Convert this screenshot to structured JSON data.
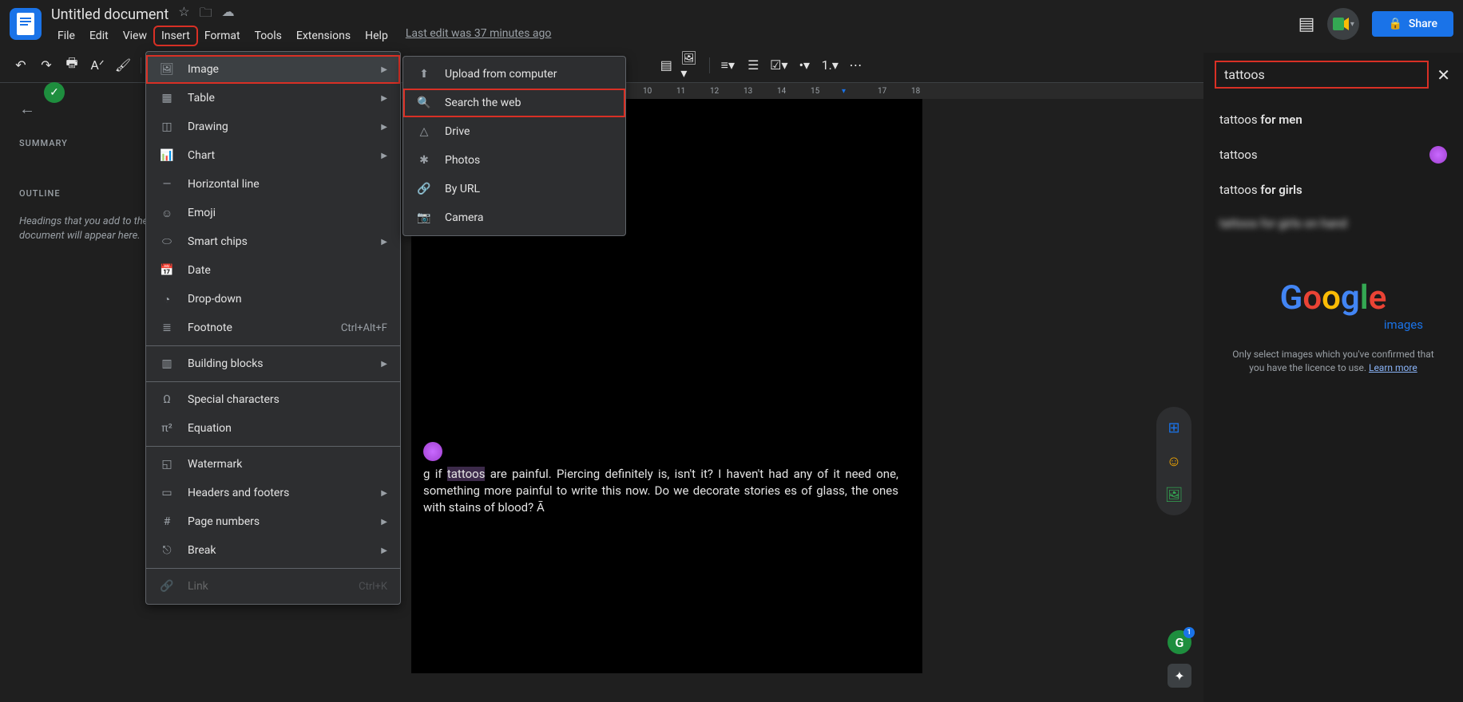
{
  "header": {
    "title": "Untitled document",
    "menus": [
      "File",
      "Edit",
      "View",
      "Insert",
      "Format",
      "Tools",
      "Extensions",
      "Help"
    ],
    "active_menu_index": 3,
    "last_edit": "Last edit was 37 minutes ago",
    "share_label": "Share"
  },
  "left_sidebar": {
    "summary": "SUMMARY",
    "outline": "OUTLINE",
    "hint": "Headings that you add to the document will appear here."
  },
  "ruler_marks": [
    10,
    11,
    12,
    13,
    14,
    15,
    17,
    18
  ],
  "insert_menu": {
    "items": [
      {
        "icon": "image-icon",
        "label": "Image",
        "arrow": true,
        "highlighted": true,
        "red": true
      },
      {
        "icon": "table-icon",
        "label": "Table",
        "arrow": true
      },
      {
        "icon": "drawing-icon",
        "label": "Drawing",
        "arrow": true
      },
      {
        "icon": "chart-icon",
        "label": "Chart",
        "arrow": true
      },
      {
        "icon": "hr-icon",
        "label": "Horizontal line"
      },
      {
        "icon": "emoji-icon",
        "label": "Emoji"
      },
      {
        "icon": "chips-icon",
        "label": "Smart chips",
        "arrow": true
      },
      {
        "icon": "date-icon",
        "label": "Date"
      },
      {
        "icon": "dropdown-icon",
        "label": "Drop-down"
      },
      {
        "icon": "footnote-icon",
        "label": "Footnote",
        "shortcut": "Ctrl+Alt+F"
      },
      {
        "divider": true
      },
      {
        "icon": "blocks-icon",
        "label": "Building blocks",
        "arrow": true
      },
      {
        "divider": true
      },
      {
        "icon": "omega-icon",
        "label": "Special characters"
      },
      {
        "icon": "equation-icon",
        "label": "Equation"
      },
      {
        "divider": true
      },
      {
        "icon": "watermark-icon",
        "label": "Watermark"
      },
      {
        "icon": "headers-icon",
        "label": "Headers and footers",
        "arrow": true
      },
      {
        "icon": "pagenum-icon",
        "label": "Page numbers",
        "arrow": true
      },
      {
        "icon": "break-icon",
        "label": "Break",
        "arrow": true
      },
      {
        "divider": true
      },
      {
        "icon": "link-icon",
        "label": "Link",
        "shortcut": "Ctrl+K",
        "cut": true
      }
    ]
  },
  "image_submenu": {
    "items": [
      {
        "icon": "upload-icon",
        "label": "Upload from computer"
      },
      {
        "icon": "search-icon",
        "label": "Search the web",
        "red": true
      },
      {
        "icon": "drive-icon",
        "label": "Drive"
      },
      {
        "icon": "photos-icon",
        "label": "Photos"
      },
      {
        "icon": "url-icon",
        "label": "By URL"
      },
      {
        "icon": "camera-icon",
        "label": "Camera"
      }
    ]
  },
  "document": {
    "text_prefix": "g if ",
    "text_highlight": "tattoos",
    "text_rest": " are painful. Piercing definitely is, isn't it? I haven't had any of it need one, something more painful to write this now. Do we decorate stories es of glass, the ones with stains of blood? Ā"
  },
  "search": {
    "query": "tattoos",
    "suggestions": [
      {
        "prefix": "tattoos ",
        "bold": "for men"
      },
      {
        "prefix": "tattoos",
        "bold": "",
        "icon": true
      },
      {
        "prefix": "tattoos ",
        "bold": "for girls"
      },
      {
        "prefix": "tattoos for girls on hand",
        "bold": "",
        "blur": true
      }
    ],
    "images_label": "images",
    "disclaimer": "Only select images which you've confirmed that you have the licence to use. ",
    "learn_more": "Learn more"
  },
  "grammarly_count": "1"
}
